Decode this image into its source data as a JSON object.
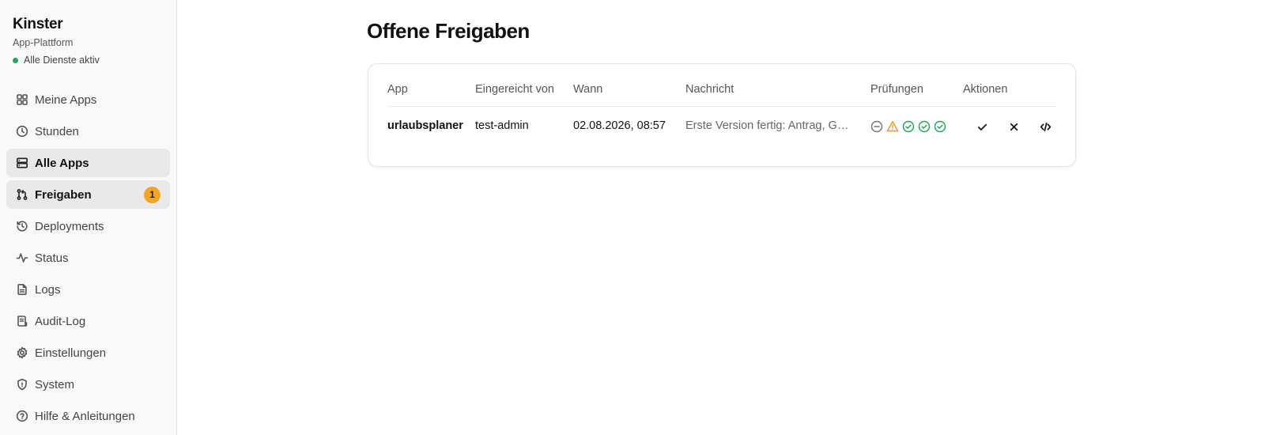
{
  "brand": {
    "title": "Kinster",
    "subtitle": "App-Plattform",
    "status": "Alle Dienste aktiv",
    "status_color": "#22a559"
  },
  "sidebar": {
    "items": [
      {
        "label": "Meine Apps",
        "icon": "grid-icon"
      },
      {
        "label": "Stunden",
        "icon": "clock-icon"
      },
      {
        "label": "Alle Apps",
        "icon": "server-icon",
        "active": true
      },
      {
        "label": "Freigaben",
        "icon": "git-pull-request-icon",
        "active": true,
        "badge": "1"
      },
      {
        "label": "Deployments",
        "icon": "history-icon"
      },
      {
        "label": "Status",
        "icon": "activity-icon"
      },
      {
        "label": "Logs",
        "icon": "file-text-icon"
      },
      {
        "label": "Audit-Log",
        "icon": "receipt-icon"
      },
      {
        "label": "Einstellungen",
        "icon": "gear-icon"
      },
      {
        "label": "System",
        "icon": "shield-icon"
      },
      {
        "label": "Hilfe & Anleitungen",
        "icon": "help-circle-icon"
      }
    ]
  },
  "main": {
    "title": "Offene Freigaben",
    "table": {
      "headers": [
        "App",
        "Eingereicht von",
        "Wann",
        "Nachricht",
        "Prüfungen",
        "Aktionen"
      ],
      "rows": [
        {
          "app": "urlaubsplaner",
          "submitted_by": "test-admin",
          "when": "02.08.2026, 08:57",
          "message": "Erste Version fertig: Antrag, Ge…",
          "checks": [
            "skipped",
            "warning",
            "passed",
            "passed",
            "passed"
          ],
          "actions": [
            "approve-icon",
            "reject-icon",
            "code-icon"
          ]
        }
      ]
    }
  },
  "colors": {
    "accent_badge": "#f5a524",
    "check_passed": "#22a559",
    "check_warning": "#e5a11a",
    "check_skipped": "#777777"
  }
}
